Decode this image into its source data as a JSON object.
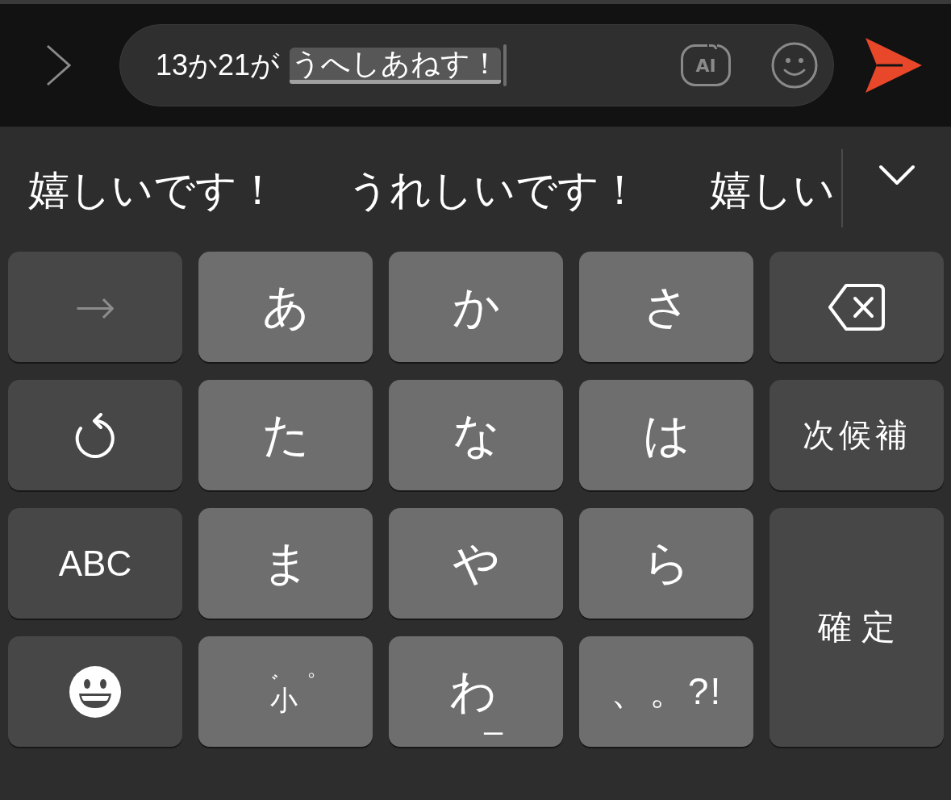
{
  "input": {
    "text": "13か21が",
    "composing": "うへしあねす！"
  },
  "ai_button": {
    "label": "AI"
  },
  "candidates": [
    {
      "text": "嬉しいです！"
    },
    {
      "text": "うれしいです！"
    },
    {
      "text": "嬉しい"
    }
  ],
  "keys": [
    {
      "kind": "arrow",
      "label": "→",
      "disabled": true
    },
    {
      "kind": "kana",
      "label": "あ",
      "disabled": false
    },
    {
      "kind": "kana",
      "label": "か",
      "disabled": false
    },
    {
      "kind": "kana",
      "label": "さ",
      "disabled": false
    },
    {
      "kind": "backspace",
      "disabled": false
    },
    {
      "kind": "undo",
      "disabled": false
    },
    {
      "kind": "kana",
      "label": "た",
      "disabled": false
    },
    {
      "kind": "kana",
      "label": "な",
      "disabled": false
    },
    {
      "kind": "kana",
      "label": "は",
      "disabled": false
    },
    {
      "kind": "text",
      "label": "次候補",
      "disabled": false
    },
    {
      "kind": "latin",
      "label": "ABC",
      "disabled": false
    },
    {
      "kind": "kana",
      "label": "ま",
      "disabled": false
    },
    {
      "kind": "kana",
      "label": "や",
      "disabled": false
    },
    {
      "kind": "kana",
      "label": "ら",
      "disabled": false
    },
    {
      "kind": "confirm",
      "label": "確定",
      "disabled": false
    },
    {
      "kind": "emoji",
      "disabled": false
    },
    {
      "kind": "dakuten",
      "parts": [
        "゛",
        "小",
        "゜"
      ],
      "disabled": false
    },
    {
      "kind": "kana",
      "label": "わ",
      "suffix": "_",
      "disabled": false
    },
    {
      "kind": "punct",
      "label": "、。?!",
      "disabled": false
    }
  ]
}
